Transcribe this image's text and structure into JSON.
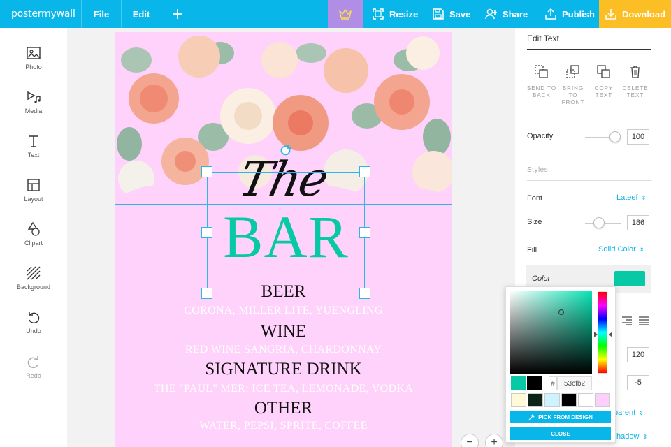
{
  "brand": {
    "logo_text": "postermywall"
  },
  "topbar": {
    "file": "File",
    "edit": "Edit",
    "resize": "Resize",
    "save": "Save",
    "share": "Share",
    "publish": "Publish",
    "download": "Download"
  },
  "sidebar": {
    "items": [
      {
        "label": "Photo",
        "icon": "photo-icon"
      },
      {
        "label": "Media",
        "icon": "media-icon"
      },
      {
        "label": "Text",
        "icon": "text-icon"
      },
      {
        "label": "Layout",
        "icon": "layout-icon"
      },
      {
        "label": "Clipart",
        "icon": "clipart-icon"
      },
      {
        "label": "Background",
        "icon": "background-icon"
      },
      {
        "label": "Undo",
        "icon": "undo-icon"
      },
      {
        "label": "Redo",
        "icon": "redo-icon"
      }
    ]
  },
  "poster": {
    "script_title": "The",
    "main_title": "BAR",
    "sections": [
      {
        "heading": "BEER",
        "items": "CORONA, MILLER LITE, YUENGLING"
      },
      {
        "heading": "WINE",
        "items": "RED WINE SANGRIA, CHARDONNAY"
      },
      {
        "heading": "SIGNATURE DRINK",
        "items": "THE \"PAUL\" MER: ICE TEA, LEMONADE, VODKA"
      },
      {
        "heading": "OTHER",
        "items": "WATER, PEPSI, SPRITE, COFFEE"
      }
    ],
    "title_color": "#08c9a6",
    "background_color": "#fed2fa"
  },
  "zoom": {
    "minus": "−",
    "plus": "+"
  },
  "panel": {
    "title": "Edit Text",
    "actions": [
      {
        "label": "SEND TO BACK",
        "icon": "send-to-back-icon"
      },
      {
        "label": "BRING TO FRONT",
        "icon": "bring-to-front-icon"
      },
      {
        "label": "COPY TEXT",
        "icon": "copy-icon"
      },
      {
        "label": "DELETE TEXT",
        "icon": "trash-icon"
      }
    ],
    "opacity_label": "Opacity",
    "opacity_value": "100",
    "styles_label": "Styles",
    "font_label": "Font",
    "font_value": "Lateef",
    "size_label": "Size",
    "size_value": "186",
    "fill_label": "Fill",
    "fill_value": "Solid Color",
    "color_label": "Color",
    "spacing_value": "120",
    "letter_spacing_value": "-5",
    "transparent_partial": "parent",
    "shadow_partial": "hadow",
    "selected_color": "#08c9a6"
  },
  "picker": {
    "hash": "#",
    "hex": "53cfb2",
    "pick_from_design": "PICK FROM DESIGN",
    "close": "CLOSE",
    "recent_colors": [
      "#08c9a6",
      "#000000"
    ],
    "presets": [
      "#fff9d6",
      "#0c2418",
      "#cdf3ff",
      "#000000",
      "#ffffff",
      "#fcd0fb"
    ]
  }
}
